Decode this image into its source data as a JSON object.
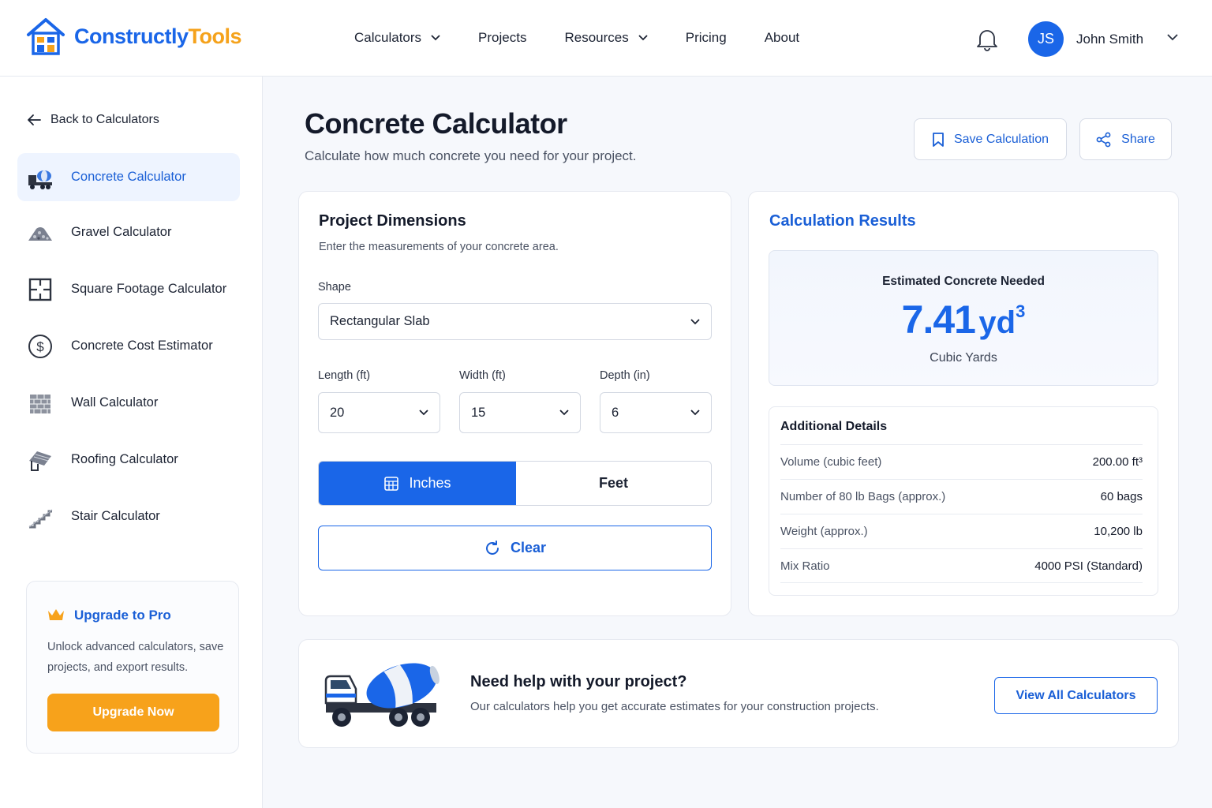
{
  "brand": {
    "name_part1": "Constructly",
    "name_part2": "Tools"
  },
  "nav": [
    {
      "label": "Calculators",
      "dropdown": true
    },
    {
      "label": "Projects",
      "dropdown": false
    },
    {
      "label": "Resources",
      "dropdown": true
    },
    {
      "label": "Pricing",
      "dropdown": false
    },
    {
      "label": "About",
      "dropdown": false
    }
  ],
  "user": {
    "initials": "JS",
    "name": "John Smith"
  },
  "sidebar": {
    "back_label": "Back to Calculators",
    "items": [
      {
        "label": "Concrete Calculator",
        "icon": "cement-mixer-icon",
        "active": true
      },
      {
        "label": "Gravel Calculator",
        "icon": "gravel-pile-icon",
        "active": false
      },
      {
        "label": "Square Footage Calculator",
        "icon": "floor-plan-icon",
        "active": false
      },
      {
        "label": "Concrete Cost Estimator",
        "icon": "dollar-icon",
        "active": false
      },
      {
        "label": "Wall Calculator",
        "icon": "brick-wall-icon",
        "active": false
      },
      {
        "label": "Roofing Calculator",
        "icon": "roof-icon",
        "active": false
      },
      {
        "label": "Stair Calculator",
        "icon": "stairs-icon",
        "active": false
      }
    ],
    "promo": {
      "title": "Upgrade to Pro",
      "text": "Unlock advanced calculators, save projects, and export results.",
      "button": "Upgrade Now"
    }
  },
  "main": {
    "title": "Concrete Calculator",
    "subtitle": "Calculate how much concrete you need for your project.",
    "save_label": "Save Calculation",
    "share_label": "Share"
  },
  "dimensions": {
    "title": "Project Dimensions",
    "subtitle": "Enter the measurements of your concrete area.",
    "shape_label": "Shape",
    "shape_value": "Rectangular Slab",
    "length_label": "Length (ft)",
    "length_value": "20",
    "width_label": "Width (ft)",
    "width_value": "15",
    "depth_label": "Depth (in)",
    "depth_value": "6",
    "unit_inches": "Inches",
    "unit_feet": "Feet",
    "selected_unit": "Inches",
    "clear_label": "Clear"
  },
  "results": {
    "title": "Calculation Results",
    "estimate_label": "Estimated Concrete Needed",
    "estimate_value": "7.41",
    "estimate_unit": "yd",
    "estimate_unit_sup": "3",
    "estimate_sub": "Cubic Yards",
    "details_title": "Additional Details",
    "details": [
      {
        "label": "Volume (cubic feet)",
        "value": "200.00 ft³"
      },
      {
        "label": "Number of 80 lb Bags (approx.)",
        "value": "60 bags"
      },
      {
        "label": "Weight (approx.)",
        "value": "10,200 lb"
      },
      {
        "label": "Mix Ratio",
        "value": "4000 PSI (Standard)"
      }
    ]
  },
  "help": {
    "title": "Need help with your project?",
    "text": "Our calculators help you get accurate estimates for your construction projects.",
    "button": "View All Calculators"
  },
  "colors": {
    "accent": "#1a66e8",
    "brand_orange": "#f7a21b",
    "text": "#141a2a"
  }
}
